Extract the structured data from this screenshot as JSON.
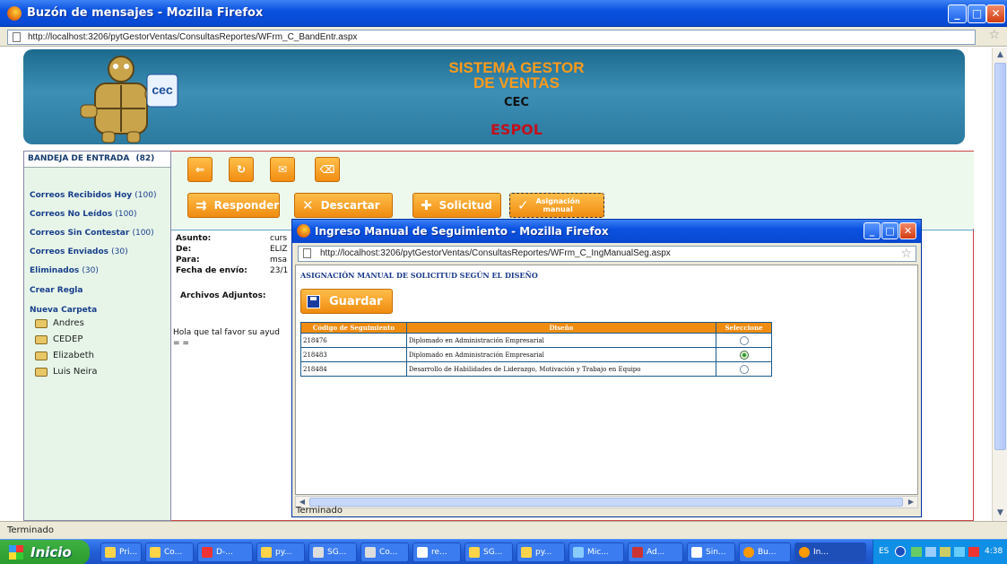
{
  "browser": {
    "title": "Buzón de mensajes - Mozilla Firefox",
    "url": "http://localhost:3206/pytGestorVentas/ConsultasReportes/WFrm_C_BandEntr.aspx",
    "status": "Terminado"
  },
  "banner": {
    "line1": "SISTEMA GESTOR",
    "line2": "DE VENTAS",
    "cec": "CEC",
    "espol": "ESPOL",
    "logo_text": "cec"
  },
  "sidebar": {
    "inbox_label": "BANDEJA DE ENTRADA",
    "inbox_count": "(82)",
    "links": [
      {
        "label": "Correos Recibidos Hoy",
        "count": "(100)"
      },
      {
        "label": "Correos No Leídos",
        "count": "(100)"
      },
      {
        "label": "Correos Sin Contestar",
        "count": "(100)"
      },
      {
        "label": "Correos Enviados",
        "count": "(30)"
      },
      {
        "label": "Eliminados",
        "count": "(30)"
      },
      {
        "label": "Crear Regla",
        "count": ""
      },
      {
        "label": "Nueva Carpeta",
        "count": ""
      }
    ],
    "folders": [
      "Andres",
      "CEDEP",
      "Elizabeth",
      "Luis Neira"
    ]
  },
  "toolbar": {
    "responder": "Responder",
    "descartar": "Descartar",
    "solicitud": "Solicitud",
    "asignacion1": "Asignación",
    "asignacion2": "manual"
  },
  "message": {
    "asunto_label": "Asunto:",
    "de_label": "De:",
    "para_label": "Para:",
    "fecha_label": "Fecha de envío:",
    "asunto": "curs",
    "de": "ELIZ",
    "para": "msa",
    "fecha": "23/1",
    "adjuntos_label": "Archivos Adjuntos:",
    "body1": "Hola que tal favor su ayud",
    "body2": "= ="
  },
  "popup": {
    "title": "Ingreso Manual de Seguimiento - Mozilla Firefox",
    "url": "http://localhost:3206/pytGestorVentas/ConsultasReportes/WFrm_C_IngManualSeg.aspx",
    "heading": "ASIGNACIÓN MANUAL DE SOLICITUD SEGÚN EL DISEÑO",
    "guardar": "Guardar",
    "status": "Terminado",
    "table": {
      "headers": [
        "Código de Seguimiento",
        "Diseño",
        "Seleccione"
      ],
      "rows": [
        {
          "code": "218476",
          "design": "Diplomado en Administración Empresarial",
          "selected": false
        },
        {
          "code": "218483",
          "design": "Diplomado en Administración Empresarial",
          "selected": true
        },
        {
          "code": "218484",
          "design": "Desarrollo de Habilidades de Liderazgo, Motivación y Trabajo en Equipo",
          "selected": false
        }
      ]
    }
  },
  "taskbar": {
    "start": "Inicio",
    "items": [
      "Pri...",
      "Co...",
      "D-...",
      "py...",
      "SG...",
      "Co...",
      "re...",
      "SG...",
      "py...",
      "Mic...",
      "Ad...",
      "Sin...",
      "Bu...",
      "In..."
    ],
    "lang": "ES",
    "clock": "4:38"
  }
}
